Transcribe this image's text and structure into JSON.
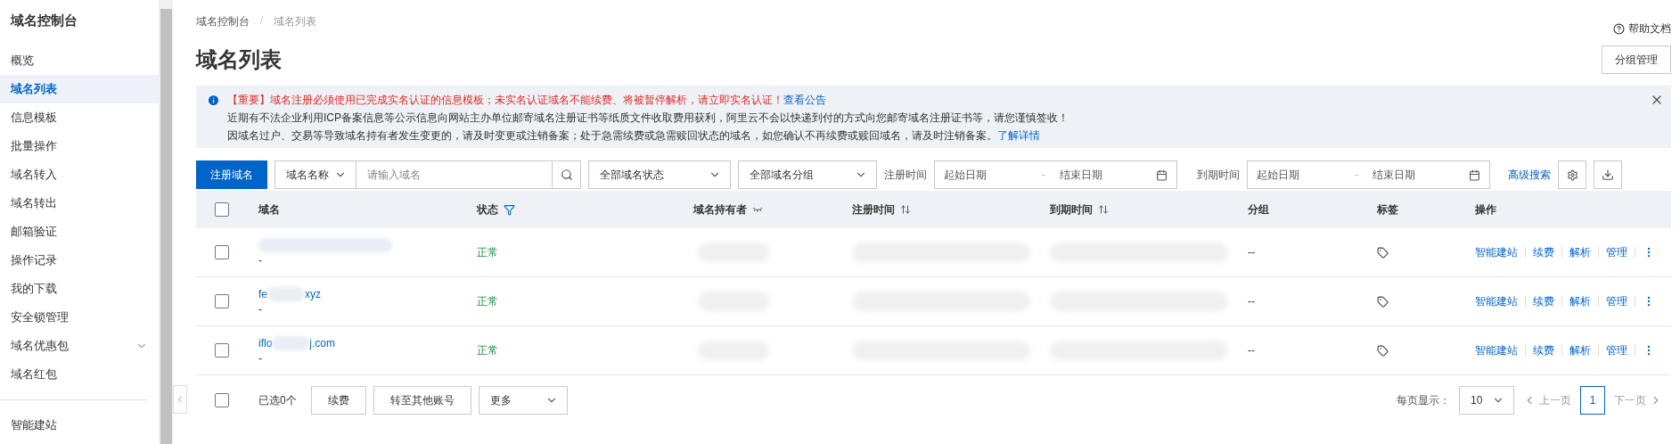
{
  "sidebar": {
    "title": "域名控制台",
    "items": [
      {
        "label": "概览",
        "selected": false
      },
      {
        "label": "域名列表",
        "selected": true
      },
      {
        "label": "信息模板",
        "selected": false
      },
      {
        "label": "批量操作",
        "selected": false
      },
      {
        "label": "域名转入",
        "selected": false
      },
      {
        "label": "域名转出",
        "selected": false
      },
      {
        "label": "邮箱验证",
        "selected": false
      },
      {
        "label": "操作记录",
        "selected": false
      },
      {
        "label": "我的下载",
        "selected": false
      },
      {
        "label": "安全锁管理",
        "selected": false
      },
      {
        "label": "域名优惠包",
        "selected": false,
        "expandable": true
      },
      {
        "label": "域名红包",
        "selected": false
      }
    ],
    "bottom_items": [
      {
        "label": "智能建站",
        "selected": false
      }
    ]
  },
  "breadcrumb": [
    "域名控制台",
    "域名列表"
  ],
  "breadcrumb_separator": "/",
  "page_title": "域名列表",
  "help_link": "帮助文档",
  "group_button": "分组管理",
  "notice": {
    "headline": "【重要】域名注册必须使用已完成实名认证的信息模板；未实名认证域名不能续费、将被暂停解析，请立即实名认证！",
    "headline_link": "查看公告",
    "line_2": "近期有不法企业利用ICP备案信息等公示信息向网站主办单位邮寄域名注册证书等纸质文件收取费用获利，阿里云不会以快递到付的方式向您邮寄域名注册证书等，请您谨慎签收！",
    "line_3": "因域名过户、交易等导致域名持有者发生变更的，请及时变更或注销备案；处于急需续费或急需赎回状态的域名，如您确认不再续费或赎回域名，请及时注销备案。",
    "line_3_link": "了解详情"
  },
  "filters": {
    "register_button": "注册域名",
    "search_type": "域名名称",
    "search_placeholder": "请输入域名",
    "status_select": "全部域名状态",
    "group_select": "全部域名分组",
    "reg_label": "注册时间",
    "reg_start": "起始日期",
    "reg_end": "结束日期",
    "exp_label": "到期时间",
    "exp_start": "起始日期",
    "exp_end": "结束日期",
    "range_separator": "-",
    "advanced_link": "高级搜索"
  },
  "table": {
    "columns": [
      "域名",
      "状态",
      "域名持有者",
      "注册时间",
      "到期时间",
      "分组",
      "标签",
      "操作"
    ],
    "rows": [
      {
        "checked": false,
        "domain_prefix": "",
        "domain_suffix": "",
        "sub": "-",
        "status": "正常",
        "group": "--",
        "actions": [
          "智能建站",
          "续费",
          "解析",
          "管理"
        ]
      },
      {
        "checked": false,
        "domain_prefix": "fe",
        "domain_suffix": "xyz",
        "sub": "-",
        "status": "正常",
        "group": "--",
        "actions": [
          "智能建站",
          "续费",
          "解析",
          "管理"
        ]
      },
      {
        "checked": false,
        "domain_prefix": "iflo",
        "domain_suffix": "j.com",
        "sub": "-",
        "status": "正常",
        "group": "--",
        "actions": [
          "智能建站",
          "续费",
          "解析",
          "管理"
        ]
      }
    ]
  },
  "footer": {
    "select_all_checked": false,
    "selected_count": "已选0个",
    "buttons": [
      "续费",
      "转至其他账号"
    ],
    "more_select": "更多",
    "page_size_label": "每页显示：",
    "page_size": "10",
    "prev": "上一页",
    "next": "下一页",
    "pages": [
      {
        "label": "1",
        "selected": true
      }
    ]
  }
}
